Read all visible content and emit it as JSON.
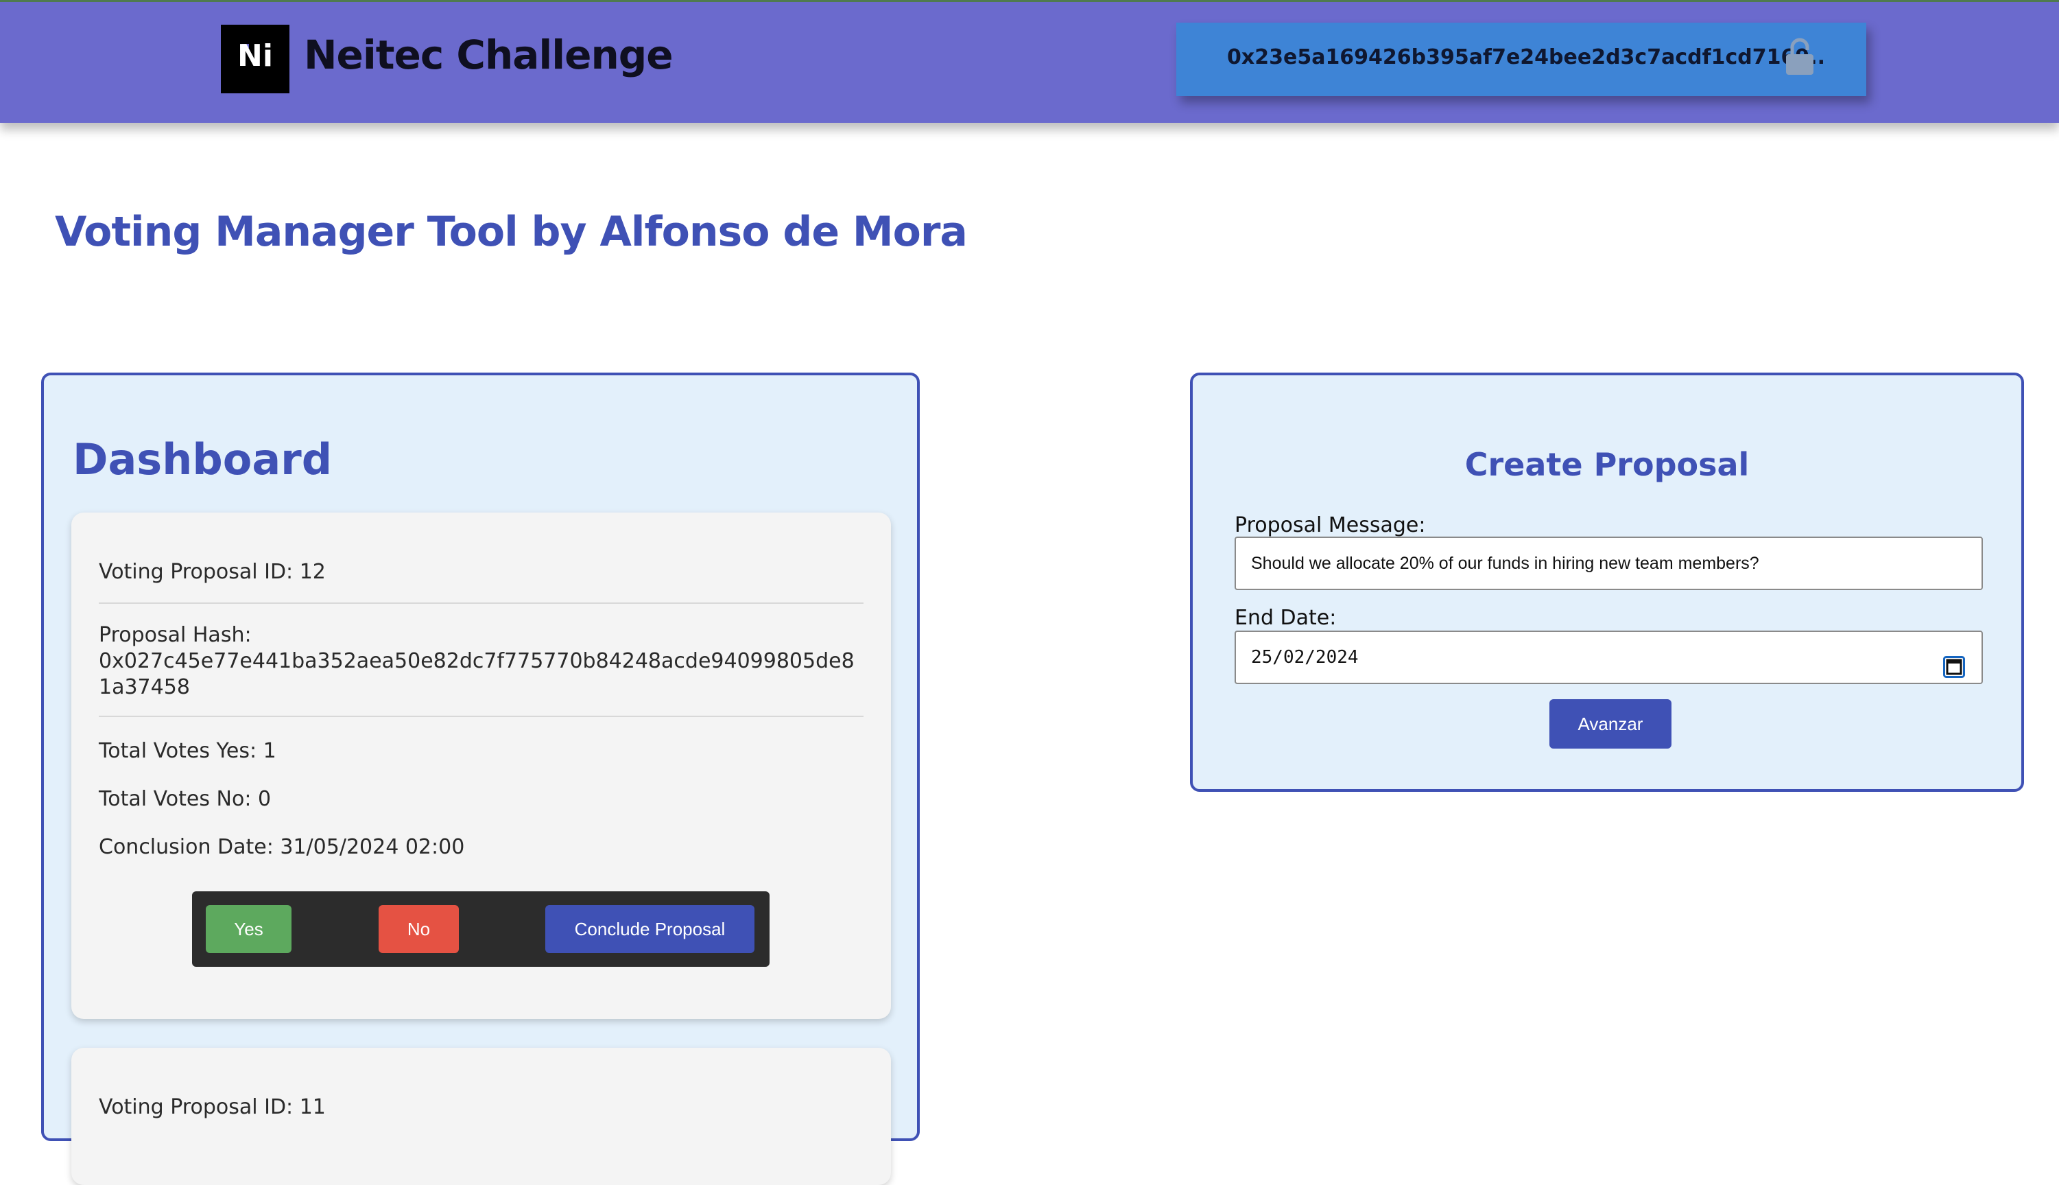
{
  "header": {
    "brand_title": "Neitec Challenge",
    "logo_text": "Ni",
    "wallet_address": "0x23e5a169426b395af7e24bee2d3c7acdf1cd7169..",
    "lock_icon": "unlock-icon"
  },
  "page": {
    "title": "Voting Manager Tool by Alfonso de Mora"
  },
  "dashboard": {
    "title": "Dashboard",
    "proposals": [
      {
        "id_text": "Voting Proposal ID: 12",
        "hash_label": "Proposal Hash:",
        "hash_value": "0x027c45e77e441ba352aea50e82dc7f775770b84248acde94099805de81a37458",
        "votes_yes_text": "Total Votes Yes: 1",
        "votes_no_text": "Total Votes No: 0",
        "conclusion_text": "Conclusion Date: 31/05/2024 02:00",
        "yes_label": "Yes",
        "no_label": "No",
        "conclude_label": "Conclude Proposal"
      },
      {
        "id_text": "Voting Proposal ID: 11"
      }
    ]
  },
  "create": {
    "title": "Create Proposal",
    "message_label": "Proposal Message:",
    "message_value": "Should we allocate 20% of our funds in hiring new team members?",
    "end_date_label": "End Date:",
    "end_date_value": "25/02/2024",
    "calendar_icon": "calendar-icon",
    "submit_label": "Avanzar"
  },
  "colors": {
    "header_bg": "#6b6acd",
    "wallet_bg": "#3e84d6",
    "accent": "#3f51b5",
    "panel_bg": "#e3f0fb",
    "yes_button": "#5da95e",
    "no_button": "#e55243"
  }
}
